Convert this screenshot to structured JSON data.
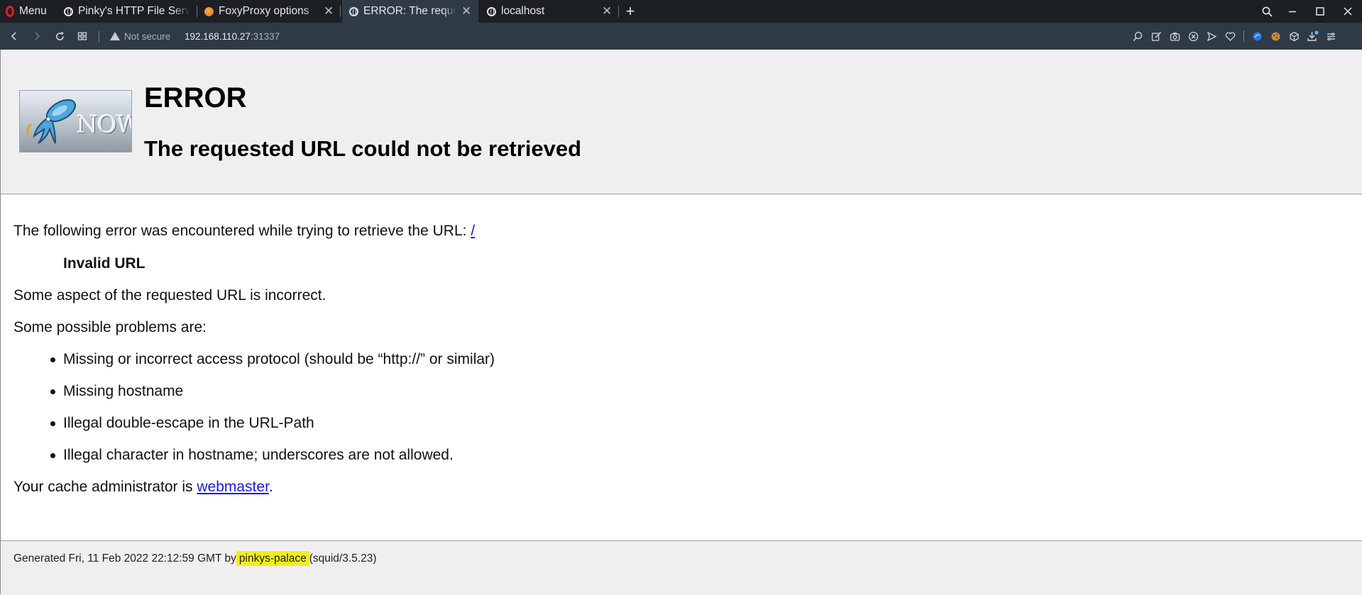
{
  "browser": {
    "menu_label": "Menu",
    "tabs": [
      {
        "title": "Pinky's HTTP File Server",
        "icon": "globe-icon"
      },
      {
        "title": "FoxyProxy options",
        "icon": "foxyproxy-icon"
      },
      {
        "title": "ERROR: The requested URL could not be retrieved",
        "icon": "globe-icon"
      },
      {
        "title": "localhost",
        "icon": "globe-icon"
      }
    ],
    "security_label": "Not secure",
    "url_host": "192.168.110.27",
    "url_port": ":31337"
  },
  "page": {
    "heading": "ERROR",
    "subheading": "The requested URL could not be retrieved",
    "logo_text": "NOW",
    "intro": "The following error was encountered while trying to retrieve the URL: ",
    "intro_link": "/",
    "error_name": "Invalid URL",
    "aspect": "Some aspect of the requested URL is incorrect.",
    "problems_intro": "Some possible problems are:",
    "problems": [
      "Missing or incorrect access protocol (should be “http://” or similar)",
      "Missing hostname",
      "Illegal double-escape in the URL-Path",
      "Illegal character in hostname; underscores are not allowed."
    ],
    "admin_prefix": "Your cache administrator is ",
    "admin_link": "webmaster",
    "admin_suffix": ".",
    "footer_prefix": "Generated Fri, 11 Feb 2022 22:12:59 GMT by",
    "footer_host": "pinkys-palace",
    "footer_suffix": "(squid/3.5.23)"
  }
}
